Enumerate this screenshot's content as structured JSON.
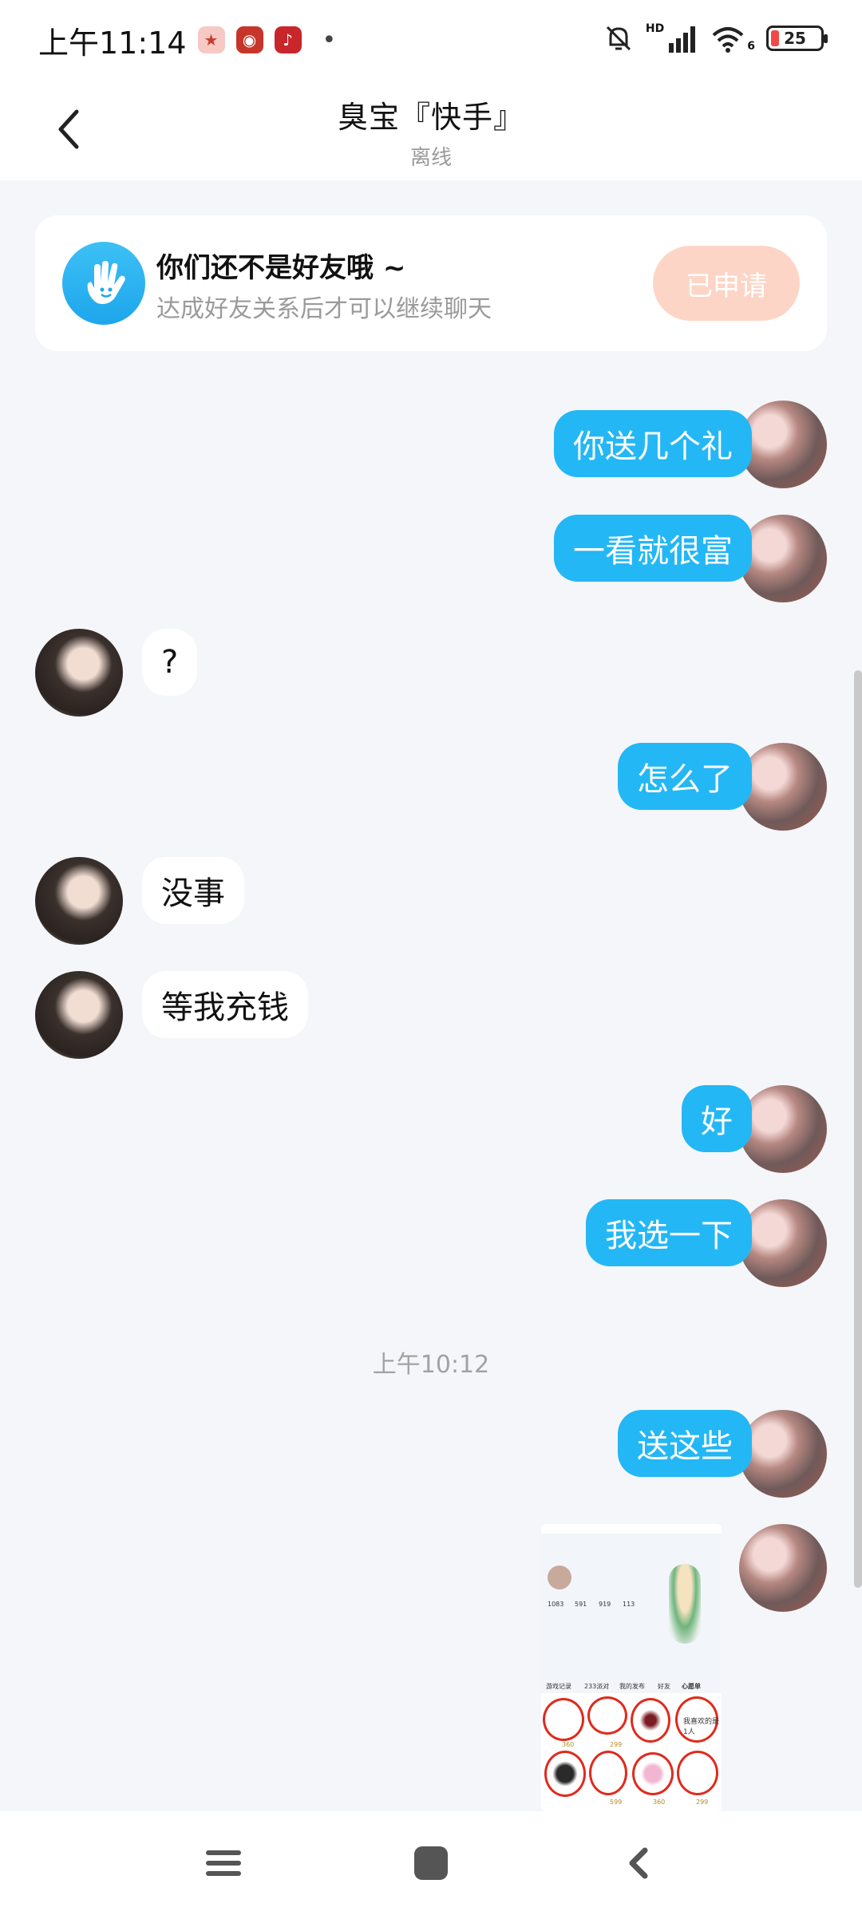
{
  "status_bar": {
    "time": "上午11:14",
    "network_label": "HD",
    "wifi_label": "6",
    "battery": "25"
  },
  "header": {
    "title": "臭宝『快手』",
    "subtitle": "离线"
  },
  "friend_banner": {
    "title": "你们还不是好友哦 ~",
    "description": "达成好友关系后才可以继续聊天",
    "button_label": "已申请"
  },
  "messages": [
    {
      "from": "me",
      "text": "你送几个礼"
    },
    {
      "from": "me",
      "text": "一看就很富"
    },
    {
      "from": "other",
      "text": "?"
    },
    {
      "from": "me",
      "text": "怎么了"
    },
    {
      "from": "other",
      "text": "没事"
    },
    {
      "from": "other",
      "text": "等我充钱"
    },
    {
      "from": "me",
      "text": "好"
    },
    {
      "from": "me",
      "text": "我选一下"
    }
  ],
  "time_separator": "上午10:12",
  "messages_after": [
    {
      "from": "me",
      "text": "送这些"
    }
  ],
  "image_message": {
    "stats": [
      "1083",
      "591",
      "919",
      "113"
    ],
    "prices": [
      "360",
      "299",
      "599",
      "360",
      "299"
    ],
    "tabs": [
      "游戏记录",
      "233派对",
      "我的发布",
      "好友",
      "心愿单"
    ],
    "caption": "我喜欢的是1人"
  },
  "nav": {
    "icons": [
      "menu-icon",
      "home-icon",
      "back-icon"
    ]
  }
}
